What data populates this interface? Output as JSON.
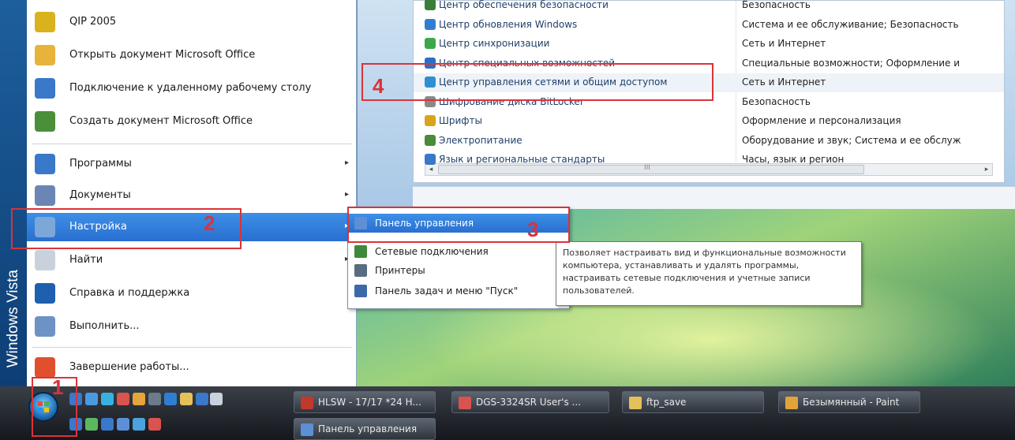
{
  "start_menu": {
    "sidebar_text": "Windows Vista",
    "pinned": [
      {
        "label": "QIP 2005",
        "icon": "qip-icon",
        "color": "#d9b21e"
      },
      {
        "label": "Открыть документ Microsoft Office",
        "icon": "office-open-icon",
        "color": "#e7b33a"
      },
      {
        "label": "Подключение к удаленному рабочему столу",
        "icon": "remote-desktop-icon",
        "color": "#3a78c9"
      },
      {
        "label": "Создать документ Microsoft Office",
        "icon": "office-new-icon",
        "color": "#4a8f3a"
      }
    ],
    "items": [
      {
        "label": "Программы",
        "icon": "programs-icon",
        "color": "#3a78c9",
        "arrow": "▸"
      },
      {
        "label": "Документы",
        "icon": "documents-icon",
        "color": "#6b86b4",
        "arrow": "▸"
      },
      {
        "label": "Настройка",
        "icon": "settings-icon",
        "color": "#7da7d9",
        "arrow": "▸"
      },
      {
        "label": "Найти",
        "icon": "search-icon",
        "color": "#c9d2dc",
        "arrow": "▸"
      },
      {
        "label": "Справка и поддержка",
        "icon": "help-icon",
        "color": "#1f5fb0"
      },
      {
        "label": "Выполнить...",
        "icon": "run-icon",
        "color": "#6c93c4"
      }
    ],
    "shutdown": {
      "label": "Завершение работы...",
      "icon": "shutdown-icon",
      "color": "#e0502f"
    }
  },
  "submenu": {
    "items": [
      {
        "label": "Панель управления",
        "icon": "control-panel-icon",
        "color": "#5c8fd6"
      },
      {
        "label": "Сетевые подключения",
        "icon": "network-connections-icon",
        "color": "#3f8a3a"
      },
      {
        "label": "Принтеры",
        "icon": "printers-icon",
        "color": "#5a6c80"
      },
      {
        "label": "Панель задач и меню \"Пуск\"",
        "icon": "taskbar-icon",
        "color": "#3c6aa8"
      }
    ]
  },
  "tooltip": {
    "text": "Позволяет настраивать вид и функциональные возможности компьютера, устанавливать и удалять программы, настраивать сетевые подключения и учетные записи пользователей."
  },
  "control_panel": {
    "rows": [
      {
        "name": "Центр обеспечения безопасности",
        "category": "Безопасность",
        "icon": "security-center-icon",
        "color": "#3a7d3a"
      },
      {
        "name": "Центр обновления Windows",
        "category": "Система и ее обслуживание; Безопасность",
        "icon": "windows-update-icon",
        "color": "#2f7fd1"
      },
      {
        "name": "Центр синхронизации",
        "category": "Сеть и Интернет",
        "icon": "sync-center-icon",
        "color": "#3aa84a"
      },
      {
        "name": "Центр специальных возможностей",
        "category": "Специальные возможности; Оформление и",
        "icon": "accessibility-icon",
        "color": "#2a6fc4"
      },
      {
        "name": "Центр управления сетями и общим доступом",
        "category": "Сеть и Интернет",
        "icon": "network-center-icon",
        "color": "#2f8fd0"
      },
      {
        "name": "Шифрование диска BitLocker",
        "category": "Безопасность",
        "icon": "bitlocker-icon",
        "color": "#8a8a8a"
      },
      {
        "name": "Шрифты",
        "category": "Оформление и персонализация",
        "icon": "fonts-icon",
        "color": "#d9a31e"
      },
      {
        "name": "Электропитание",
        "category": "Оборудование и звук; Система и ее обслуж",
        "icon": "power-icon",
        "color": "#4a8a3a"
      },
      {
        "name": "Язык и региональные стандарты",
        "category": "Часы, язык и регион",
        "icon": "region-icon",
        "color": "#3a78c9"
      }
    ],
    "scroll_thumb_glyph": "III"
  },
  "annotations": [
    "1",
    "2",
    "3",
    "4"
  ],
  "taskbar": {
    "buttons": [
      {
        "label": "HLSW - 17/17 *24 H...",
        "icon": "hlsw-icon",
        "color": "#c0392b"
      },
      {
        "label": "DGS-3324SR User's ...",
        "icon": "pdf-icon",
        "color": "#d9534f"
      },
      {
        "label": "ftp_save",
        "icon": "folder-icon",
        "color": "#e5c15a"
      },
      {
        "label": "Безымянный - Paint",
        "icon": "paint-icon",
        "color": "#e3a33a"
      },
      {
        "label": "Панель управления",
        "icon": "control-panel-icon",
        "color": "#5c8fd6"
      }
    ],
    "quicklaunch_colors": [
      "#3a78c9",
      "#4a9ae0",
      "#3ab0e0",
      "#d9534f",
      "#e5a53a",
      "#6c7a89",
      "#2f7fd1",
      "#e5c15a",
      "#3a78c9",
      "#c9d2dc",
      "#3a78c9",
      "#5cb85c",
      "#3a78c9",
      "#5c8fd6",
      "#4aa3df",
      "#d9534f"
    ]
  }
}
